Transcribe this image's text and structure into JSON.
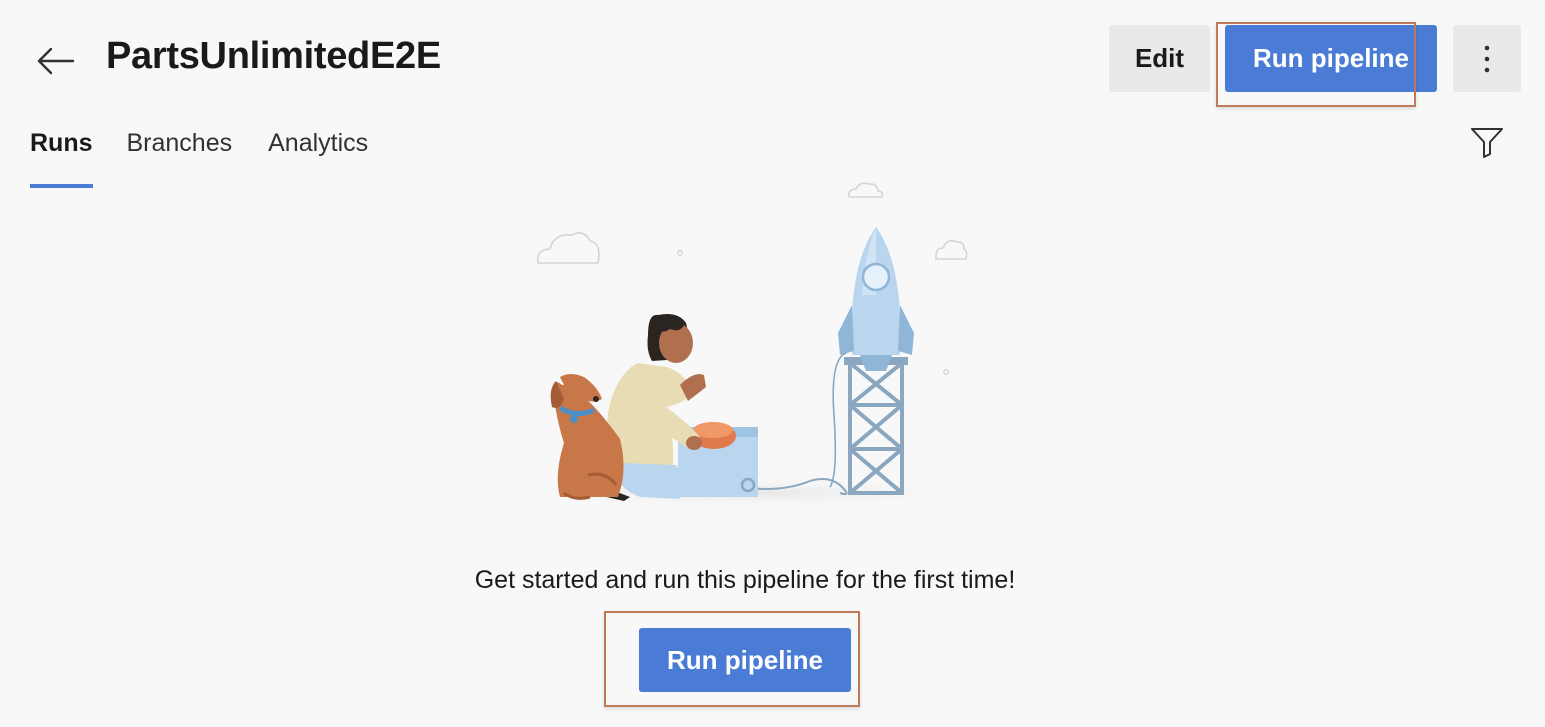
{
  "header": {
    "title": "PartsUnlimitedE2E",
    "back_icon": "arrow-left-icon",
    "edit_label": "Edit",
    "run_pipeline_label": "Run pipeline",
    "more_icon": "more-vertical-icon"
  },
  "tabs": [
    {
      "label": "Runs",
      "active": true
    },
    {
      "label": "Branches",
      "active": false
    },
    {
      "label": "Analytics",
      "active": false
    }
  ],
  "toolbar": {
    "filter_icon": "filter-icon"
  },
  "empty_state": {
    "illustration": "person-dog-rocket-launch-illustration",
    "message": "Get started and run this pipeline for the first time!",
    "run_pipeline_label": "Run pipeline"
  },
  "colors": {
    "accent": "#4a7cd6",
    "highlight_border": "#c0785a",
    "background": "#f8f8f8",
    "secondary_button": "#e9e9e9"
  }
}
